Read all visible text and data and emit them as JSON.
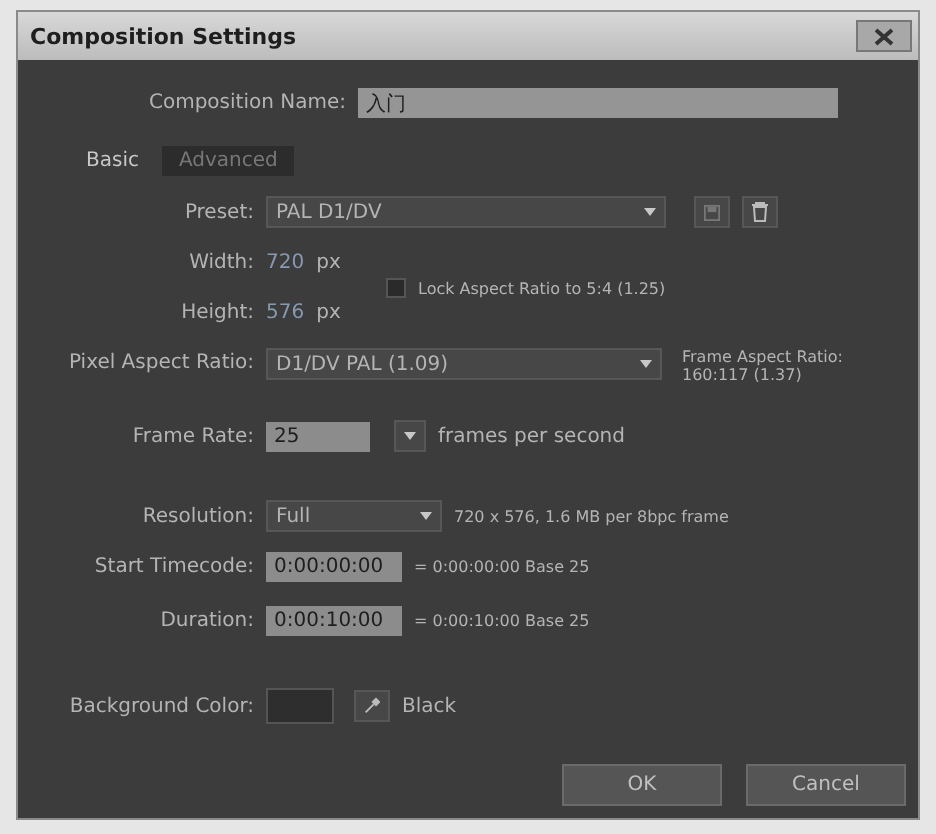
{
  "window": {
    "title": "Composition Settings"
  },
  "composition_name": {
    "label": "Composition Name:",
    "value": "入门"
  },
  "tabs": [
    {
      "label": "Basic",
      "selected": true
    },
    {
      "label": "Advanced",
      "selected": false
    }
  ],
  "preset": {
    "label": "Preset:",
    "value": "PAL D1/DV"
  },
  "width": {
    "label": "Width:",
    "value": "720",
    "unit": "px"
  },
  "height": {
    "label": "Height:",
    "value": "576",
    "unit": "px"
  },
  "lock_aspect": {
    "label": "Lock Aspect Ratio to 5:4 (1.25)",
    "checked": false
  },
  "pixel_aspect_ratio": {
    "label": "Pixel Aspect Ratio:",
    "value": "D1/DV PAL (1.09)"
  },
  "frame_aspect_ratio": {
    "label": "Frame Aspect Ratio:",
    "value": "160:117 (1.37)"
  },
  "frame_rate": {
    "label": "Frame Rate:",
    "value": "25",
    "unit": "frames per second"
  },
  "resolution": {
    "label": "Resolution:",
    "value": "Full",
    "info": "720 x 576, 1.6 MB per 8bpc frame"
  },
  "start_timecode": {
    "label": "Start Timecode:",
    "value": "0:00:00:00",
    "info": "= 0:00:00:00  Base 25"
  },
  "duration": {
    "label": "Duration:",
    "value": "0:00:10:00",
    "info": "= 0:00:10:00  Base 25"
  },
  "background_color": {
    "label": "Background Color:",
    "color": "#2e2e2e",
    "name": "Black"
  },
  "buttons": [
    {
      "label": "OK"
    },
    {
      "label": "Cancel"
    }
  ]
}
